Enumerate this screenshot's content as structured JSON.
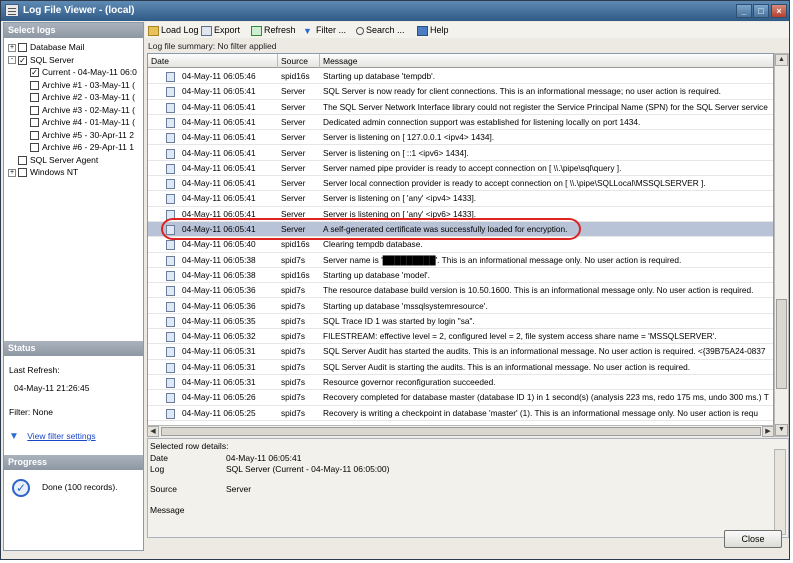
{
  "window": {
    "title": "Log File Viewer - (local)"
  },
  "left": {
    "select_logs_header": "Select logs",
    "tree": [
      {
        "label": "Database Mail",
        "indent": 0,
        "expander": "+",
        "checked": false
      },
      {
        "label": "SQL Server",
        "indent": 0,
        "expander": "-",
        "checked": true
      },
      {
        "label": "Current - 04-May-11 06:0",
        "indent": 1,
        "checked": true
      },
      {
        "label": "Archive #1 - 03-May-11 (",
        "indent": 1,
        "checked": false
      },
      {
        "label": "Archive #2 - 03-May-11 (",
        "indent": 1,
        "checked": false
      },
      {
        "label": "Archive #3 - 02-May-11 (",
        "indent": 1,
        "checked": false
      },
      {
        "label": "Archive #4 - 01-May-11 (",
        "indent": 1,
        "checked": false
      },
      {
        "label": "Archive #5 - 30-Apr-11 2",
        "indent": 1,
        "checked": false
      },
      {
        "label": "Archive #6 - 29-Apr-11 1",
        "indent": 1,
        "checked": false
      },
      {
        "label": "SQL Server Agent",
        "indent": 0,
        "expander": "",
        "checked": false
      },
      {
        "label": "Windows NT",
        "indent": 0,
        "expander": "+",
        "checked": false
      }
    ],
    "status_header": "Status",
    "last_refresh_label": "Last Refresh:",
    "last_refresh_value": "04-May-11 21:26:45",
    "filter_label": "Filter: None",
    "view_filter_link": "View filter settings",
    "progress_header": "Progress",
    "progress_text": "Done (100 records)."
  },
  "toolbar": {
    "load_log": "Load Log",
    "export": "Export",
    "refresh": "Refresh",
    "filter": "Filter ...",
    "search": "Search ...",
    "help": "Help"
  },
  "summary": "Log file summary: No filter applied",
  "grid": {
    "columns": [
      "Date",
      "Source",
      "Message"
    ],
    "rows": [
      [
        "04-May-11 06:05:46",
        "spid16s",
        "Starting up database 'tempdb'."
      ],
      [
        "04-May-11 06:05:41",
        "Server",
        "SQL Server is now ready for client connections. This is an informational message; no user action is required."
      ],
      [
        "04-May-11 06:05:41",
        "Server",
        "The SQL Server Network Interface library could not register the Service Principal Name (SPN) for the SQL Server service"
      ],
      [
        "04-May-11 06:05:41",
        "Server",
        "Dedicated admin connection support was established for listening locally on port 1434."
      ],
      [
        "04-May-11 06:05:41",
        "Server",
        "Server is listening on [ 127.0.0.1 <ipv4> 1434]."
      ],
      [
        "04-May-11 06:05:41",
        "Server",
        "Server is listening on [ ::1 <ipv6> 1434]."
      ],
      [
        "04-May-11 06:05:41",
        "Server",
        "Server named pipe provider is ready to accept connection on [ \\\\.\\pipe\\sql\\query ]."
      ],
      [
        "04-May-11 06:05:41",
        "Server",
        "Server local connection provider is ready to accept connection on [ \\\\.\\pipe\\SQLLocal\\MSSQLSERVER ]."
      ],
      [
        "04-May-11 06:05:41",
        "Server",
        "Server is listening on [ 'any' <ipv4> 1433]."
      ],
      [
        "04-May-11 06:05:41",
        "Server",
        "Server is listening on [ 'any' <ipv6> 1433]."
      ],
      [
        "04-May-11 06:05:41",
        "Server",
        "A self-generated certificate was successfully loaded for encryption."
      ],
      [
        "04-May-11 06:05:40",
        "spid16s",
        "Clearing tempdb database."
      ],
      [
        "04-May-11 06:05:38",
        "spid7s",
        "Server name is '█████████'. This is an informational message only. No user action is required."
      ],
      [
        "04-May-11 06:05:38",
        "spid16s",
        "Starting up database 'model'."
      ],
      [
        "04-May-11 06:05:36",
        "spid7s",
        "The resource database build version is 10.50.1600. This is an informational message only. No user action is required."
      ],
      [
        "04-May-11 06:05:36",
        "spid7s",
        "Starting up database 'mssqlsystemresource'."
      ],
      [
        "04-May-11 06:05:35",
        "spid7s",
        "SQL Trace ID 1 was started by login \"sa\"."
      ],
      [
        "04-May-11 06:05:32",
        "spid7s",
        "FILESTREAM: effective level = 2, configured level = 2, file system access share name = 'MSSQLSERVER'."
      ],
      [
        "04-May-11 06:05:31",
        "spid7s",
        "SQL Server Audit has started the audits. This is an informational message. No user action is required.  <{39B75A24-0837"
      ],
      [
        "04-May-11 06:05:31",
        "spid7s",
        "SQL Server Audit is starting the audits. This is an informational message. No user action is required."
      ],
      [
        "04-May-11 06:05:31",
        "spid7s",
        "Resource governor reconfiguration succeeded."
      ],
      [
        "04-May-11 06:05:26",
        "spid7s",
        "Recovery completed for database master (database ID 1) in 1 second(s) (analysis 223 ms, redo 175 ms, undo 300 ms.) T"
      ],
      [
        "04-May-11 06:05:25",
        "spid7s",
        "Recovery is writing a checkpoint in database 'master' (1). This is an informational message only. No user action is requ"
      ]
    ],
    "selected_index": 10
  },
  "details": {
    "header": "Selected row details:",
    "date_label": "Date",
    "date_value": "04-May-11 06:05:41",
    "log_label": "Log",
    "log_value": "SQL Server (Current - 04-May-11 06:05:00)",
    "source_label": "Source",
    "source_value": "Server",
    "message_label": "Message"
  },
  "close_button": "Close",
  "colors": {
    "selection": "#b9c3d8",
    "annotation": "#dd2222",
    "titlebar": "#2f5a86"
  }
}
